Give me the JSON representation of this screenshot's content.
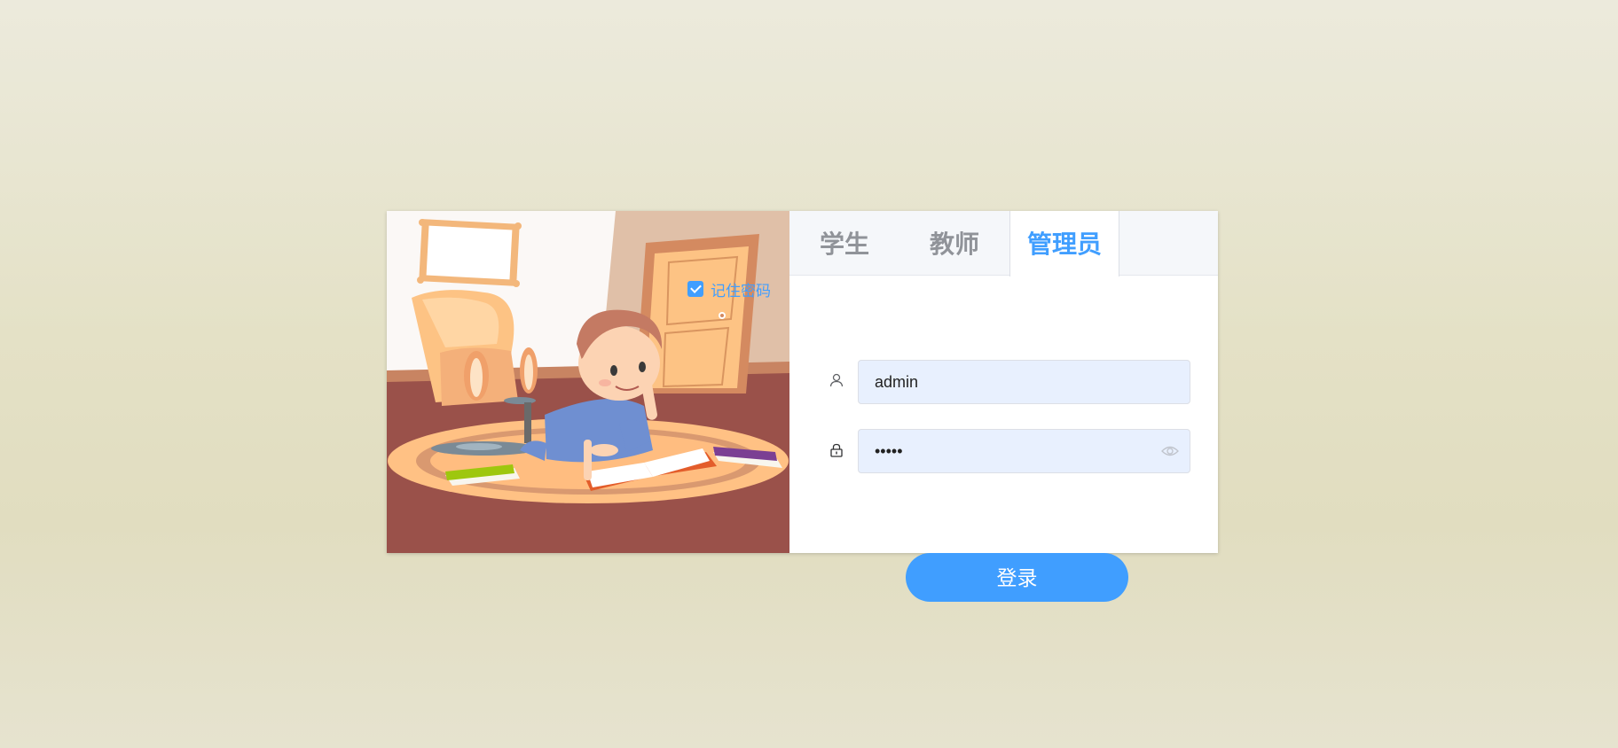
{
  "tabs": [
    {
      "label": "学生",
      "active": false
    },
    {
      "label": "教师",
      "active": false
    },
    {
      "label": "管理员",
      "active": true
    }
  ],
  "username": {
    "value": "admin",
    "icon": "user-icon"
  },
  "password": {
    "value": "•••••",
    "icon": "lock-icon",
    "toggle_icon": "eye-icon"
  },
  "remember": {
    "label": "记住密码",
    "checked": true
  },
  "login_button": {
    "label": "登录"
  },
  "colors": {
    "accent": "#409eff",
    "tab_inactive": "#909399",
    "input_bg": "#e8f0fe"
  }
}
